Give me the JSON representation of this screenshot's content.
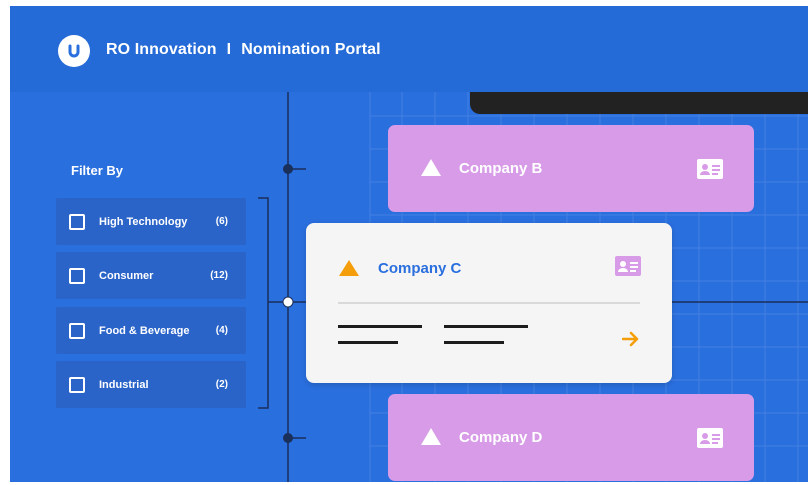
{
  "header": {
    "brand": "RO Innovation",
    "separator": "I",
    "portal": "Nomination Portal"
  },
  "filter": {
    "title": "Filter By",
    "items": [
      {
        "label": "High Technology",
        "count": "(6)"
      },
      {
        "label": "Consumer",
        "count": "(12)"
      },
      {
        "label": "Food & Beverage",
        "count": "(4)"
      },
      {
        "label": "Industrial",
        "count": "(2)"
      }
    ]
  },
  "companies": [
    {
      "name": "Company B"
    },
    {
      "name": "Company C"
    },
    {
      "name": "Company D"
    }
  ],
  "colors": {
    "background": "#2a6fde",
    "card_collapsed": "#d89be8",
    "card_expanded": "#f5f5f5",
    "accent": "#f59e0b",
    "company_name_active": "#2a6fde"
  },
  "icons": {
    "logo": "u-logo-icon",
    "company_marker": "triangle-icon",
    "profile": "id-card-icon",
    "open": "arrow-right-icon"
  }
}
